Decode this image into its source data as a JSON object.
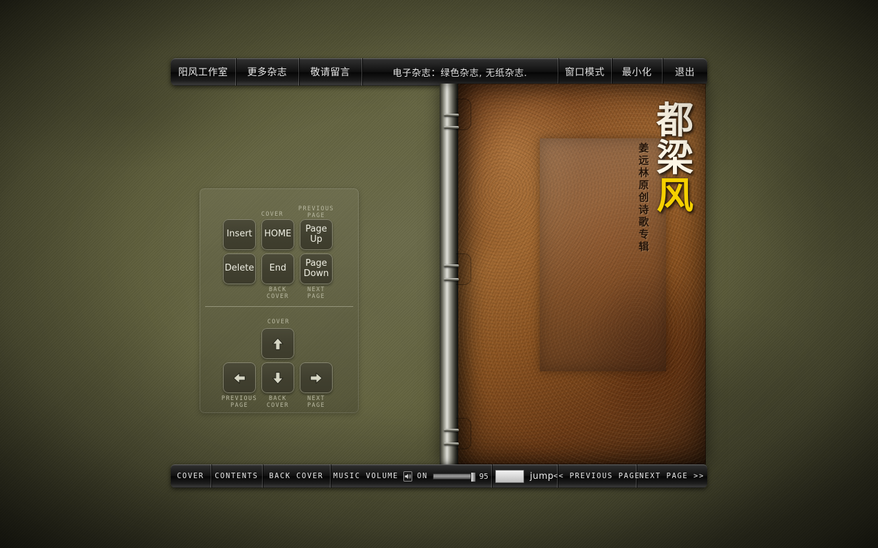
{
  "app": {
    "background_color": "#63633f",
    "accent_color": "#f5d000"
  },
  "top_toolbar": {
    "items": [
      {
        "label": "阳风工作室",
        "name": "studio"
      },
      {
        "label": "更多杂志",
        "name": "more-magazines"
      },
      {
        "label": "敬请留言",
        "name": "leave-message"
      },
      {
        "label": "电子杂志：绿色杂志, 无纸杂志.",
        "name": "tagline"
      },
      {
        "label": "窗口模式",
        "name": "window-mode"
      },
      {
        "label": "最小化",
        "name": "minimize"
      },
      {
        "label": "退出",
        "name": "exit"
      }
    ]
  },
  "book": {
    "cover_title_chars": [
      "都",
      "梁",
      "风"
    ],
    "cover_subtitle": "姜远林原创诗歌专辑"
  },
  "help_panel": {
    "keys": [
      {
        "key": "Insert",
        "label": ""
      },
      {
        "key": "HOME",
        "label": "COVER"
      },
      {
        "key": "Page\nUp",
        "label": "PREVIOUS\nPAGE"
      },
      {
        "key": "Delete",
        "label": ""
      },
      {
        "key": "End",
        "label": "BACK\nCOVER"
      },
      {
        "key": "Page\nDown",
        "label": "NEXT\nPAGE"
      }
    ],
    "key_insert": "Insert",
    "key_home": "HOME",
    "key_pageup": "Page Up",
    "key_delete": "Delete",
    "key_end": "End",
    "key_pagedown": "Page Down",
    "label_home_top": "COVER",
    "label_pageup_top_1": "PREVIOUS",
    "label_pageup_top_2": "PAGE",
    "label_end_bottom_1": "BACK",
    "label_end_bottom_2": "COVER",
    "label_pagedown_bottom_1": "NEXT",
    "label_pagedown_bottom_2": "PAGE",
    "arrows": {
      "up_label": "COVER",
      "left_label_1": "PREVIOUS",
      "left_label_2": "PAGE",
      "down_label_1": "BACK",
      "down_label_2": "COVER",
      "right_label_1": "NEXT",
      "right_label_2": "PAGE"
    }
  },
  "bottom_toolbar": {
    "cover": "COVER",
    "contents": "CONTENTS",
    "back_cover": "BACK COVER",
    "music_volume_label": "MUSIC VOLUME",
    "music_state": "ON",
    "volume_value": "95",
    "jump_value": "",
    "jump_placeholder": "",
    "jump_label": "jump",
    "previous_page": "<< PREVIOUS PAGE",
    "next_page": "NEXT PAGE >>"
  }
}
